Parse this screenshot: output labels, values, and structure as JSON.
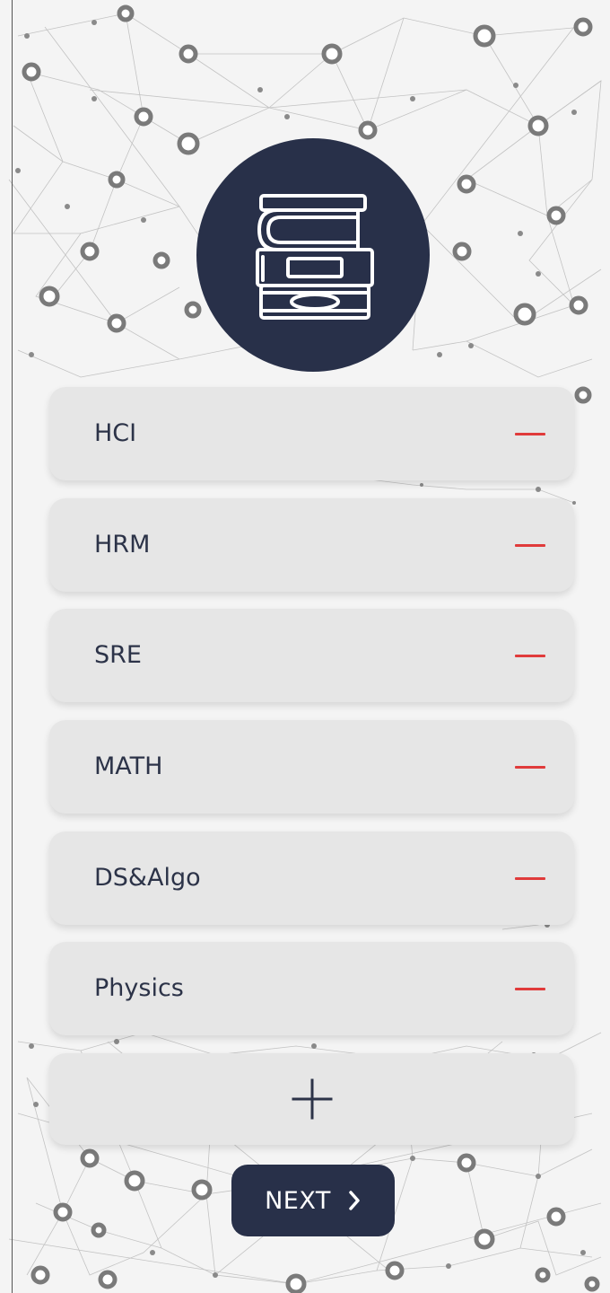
{
  "subjects": [
    {
      "name": "HCI",
      "action_icon": "minus-icon"
    },
    {
      "name": "HRM",
      "action_icon": "minus-icon"
    },
    {
      "name": "SRE",
      "action_icon": "minus-icon"
    },
    {
      "name": "MATH",
      "action_icon": "minus-icon"
    },
    {
      "name": "DS&Algo",
      "action_icon": "minus-icon"
    },
    {
      "name": "Physics",
      "action_icon": "minus-icon"
    }
  ],
  "add_button": {
    "icon": "plus-icon"
  },
  "next_button": {
    "label": "NEXT",
    "icon": "chevron-right-icon"
  },
  "logo": {
    "icon": "books-icon"
  },
  "colors": {
    "primary": "#283049",
    "card": "#e6e6e6",
    "remove": "#e03b3b",
    "text": "#2c3348"
  }
}
